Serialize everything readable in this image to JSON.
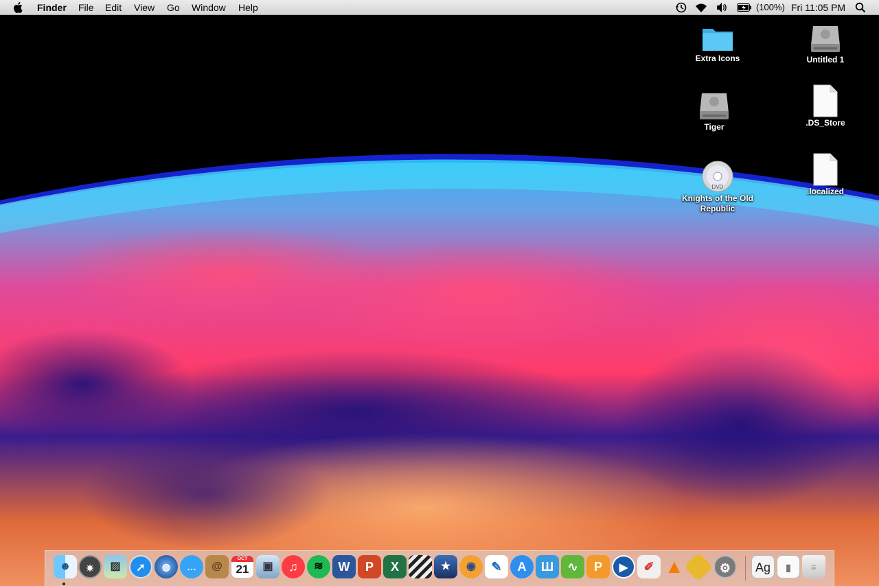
{
  "menubar": {
    "app_name": "Finder",
    "menus": [
      "File",
      "Edit",
      "View",
      "Go",
      "Window",
      "Help"
    ],
    "status": {
      "battery": "(100%)",
      "clock": "Fri 11:05 PM"
    },
    "icons": [
      "apple-logo",
      "time-machine-icon",
      "wifi-icon",
      "volume-icon",
      "battery-icon",
      "spotlight-search-icon"
    ]
  },
  "desktop": {
    "icons": [
      {
        "label": "Extra Icons",
        "kind": "folder"
      },
      {
        "label": "Untitled 1",
        "kind": "hard-drive"
      },
      {
        "label": "Tiger",
        "kind": "hard-drive"
      },
      {
        "label": ".DS_Store",
        "kind": "document"
      },
      {
        "label": "Knights of the Old Republic",
        "kind": "dvd"
      },
      {
        "label": ".localized",
        "kind": "document"
      }
    ]
  },
  "dock": {
    "apps": [
      "Finder",
      "Launchpad",
      "Preview",
      "Safari",
      "Internet globe",
      "Messages",
      "Contacts",
      "Calendar",
      "iPhoto",
      "iTunes",
      "Spotify",
      "Word",
      "PowerPoint",
      "Excel",
      "Final Cut",
      "iMovie",
      "Blender",
      "Feather",
      "App Store",
      "Wunderlist",
      "Gesture",
      "Pages",
      "QuickTime",
      "Paint",
      "VLC",
      "Gamepad",
      "System Preferences",
      "Font Book",
      "Archive",
      "Trash"
    ],
    "calendar_day": "21",
    "calendar_month": "OCT",
    "fontbook_label": "Ag",
    "word_letter": "W",
    "powerpoint_letter": "P",
    "excel_letter": "X"
  },
  "colors": {
    "menubar": "#e6e6e6",
    "folder_blue": "#5bc8f5",
    "itunes_red": "#fc3c44",
    "spotify_green": "#1db954",
    "word_blue": "#2b579a",
    "powerpoint_orange": "#d24726",
    "excel_green": "#217346"
  }
}
